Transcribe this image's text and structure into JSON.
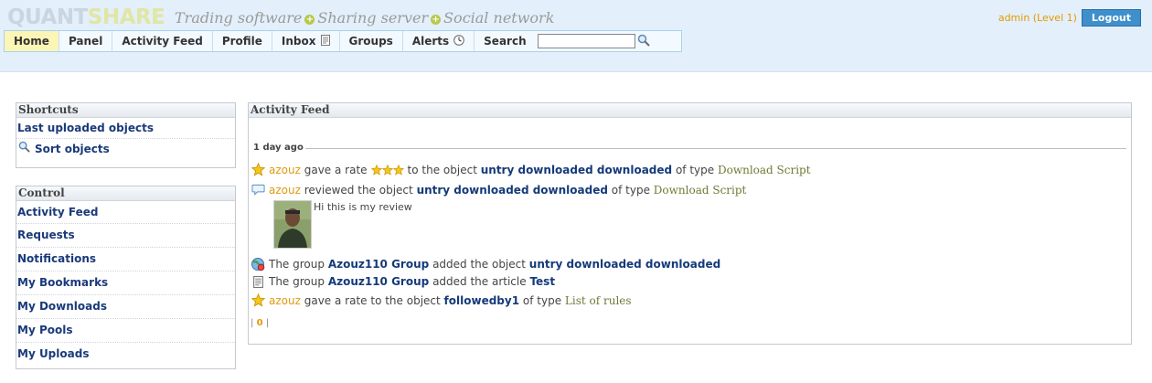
{
  "header": {
    "logo_part1": "QUANT",
    "logo_part2": "SHARE",
    "tagline": [
      "Trading software",
      "Sharing server",
      "Social network"
    ],
    "user": "admin (Level 1)",
    "logout": "Logout"
  },
  "nav": {
    "home": "Home",
    "panel": "Panel",
    "activity_feed": "Activity Feed",
    "profile": "Profile",
    "inbox": "Inbox",
    "groups": "Groups",
    "alerts": "Alerts",
    "search": "Search",
    "search_value": ""
  },
  "shortcuts": {
    "title": "Shortcuts",
    "items": [
      "Last uploaded objects",
      "Sort objects"
    ]
  },
  "control": {
    "title": "Control",
    "items": [
      "Activity Feed",
      "Requests",
      "Notifications",
      "My Bookmarks",
      "My Downloads",
      "My Pools",
      "My Uploads"
    ]
  },
  "feed": {
    "title": "Activity Feed",
    "date": "1 day ago",
    "entries": [
      {
        "user": "azouz",
        "text1": "gave a rate",
        "text2": "to the object",
        "object": "untry downloaded downloaded",
        "text3": "of type",
        "type": "Download Script",
        "rating": 3
      },
      {
        "user": "azouz",
        "text1": "reviewed the object",
        "object": "untry downloaded downloaded",
        "text3": "of type",
        "type": "Download Script"
      },
      {
        "text0": "The group",
        "group": "Azouz110 Group",
        "text1": "added the object",
        "object": "untry downloaded downloaded"
      },
      {
        "text0": "The group",
        "group": "Azouz110 Group",
        "text1": "added the article",
        "object": "Test"
      },
      {
        "user": "azouz",
        "text1": "gave a rate to the object",
        "object": "followedby1",
        "text3": "of type",
        "type": "List of rules"
      }
    ],
    "review": "Hi this is my review",
    "pager_sep": "|",
    "pager_current": "0"
  },
  "colors": {
    "header_bg": "#e3effa",
    "nav_active": "#fbf6b6",
    "link": "#153a7a",
    "user": "#e09a10",
    "logout": "#3e8fcc"
  }
}
